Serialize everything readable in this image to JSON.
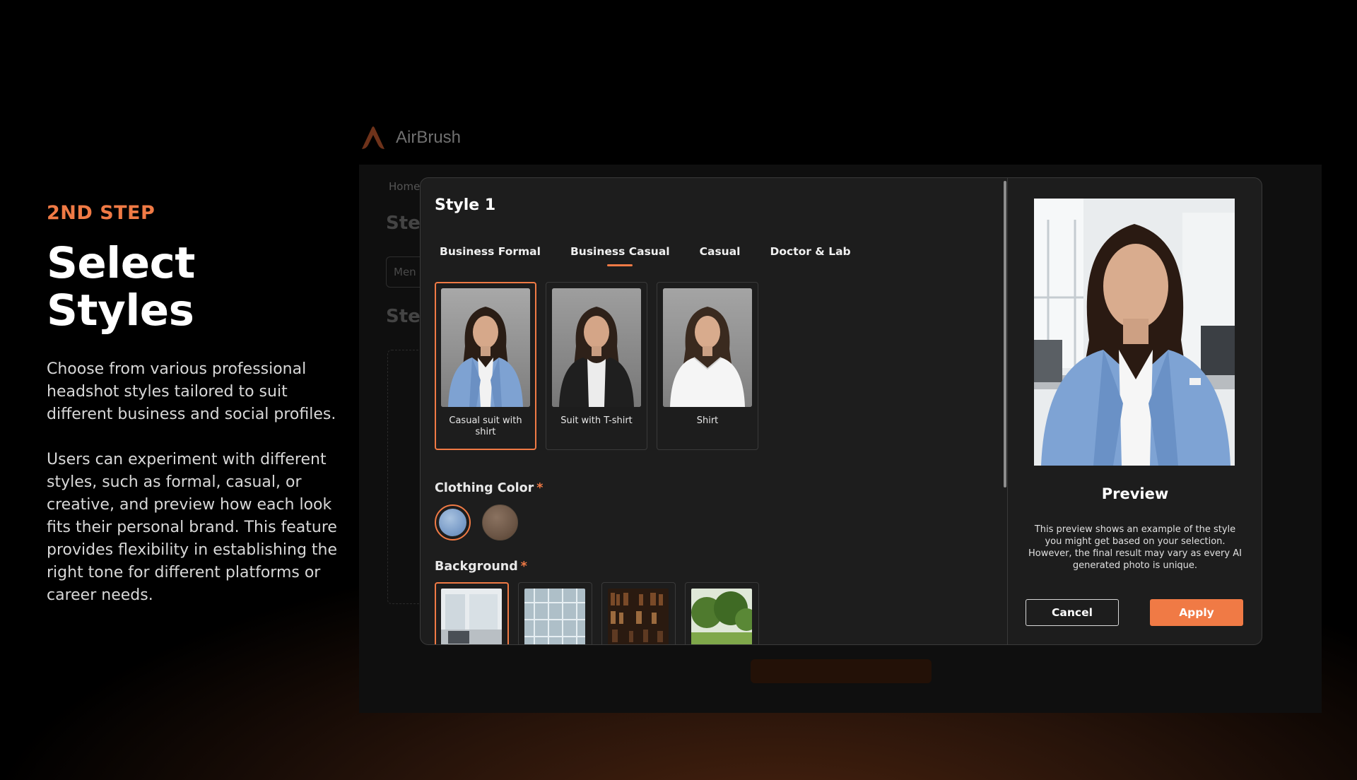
{
  "intro": {
    "step": "2ND STEP",
    "title": "Select Styles",
    "paragraph1": "Choose from various professional headshot styles tailored to suit different business and social profiles.",
    "paragraph2": "Users can experiment with different styles, such as formal, casual, or creative, and preview how each look fits their personal brand. This feature provides flexibility in establishing the right tone for different platforms or career needs."
  },
  "background_app": {
    "brand": "AirBrush",
    "breadcrumb": "Home",
    "step1": "Ste",
    "select": "Men",
    "step2": "Ste"
  },
  "modal": {
    "title": "Style 1",
    "tabs": [
      {
        "label": "Business Formal",
        "active": false
      },
      {
        "label": "Business Casual",
        "active": true
      },
      {
        "label": "Casual",
        "active": false
      },
      {
        "label": "Doctor & Lab",
        "active": false
      }
    ],
    "styles": [
      {
        "label": "Casual suit with shirt",
        "selected": true
      },
      {
        "label": "Suit with T-shirt",
        "selected": false
      },
      {
        "label": "Shirt",
        "selected": false
      }
    ],
    "clothing_color": {
      "label": "Clothing Color",
      "required_mark": "*",
      "options": [
        {
          "name": "light-blue",
          "color": "#7b9dc9",
          "selected": true
        },
        {
          "name": "brown",
          "color": "#6c5646",
          "selected": false
        }
      ]
    },
    "background": {
      "label": "Background",
      "required_mark": "*",
      "options": [
        {
          "name": "office",
          "selected": true
        },
        {
          "name": "glass-building",
          "selected": false
        },
        {
          "name": "library",
          "selected": false
        },
        {
          "name": "park",
          "selected": false
        }
      ]
    },
    "preview": {
      "title": "Preview",
      "description": "This preview shows an example of the style you might get based on your selection. However, the final result may vary as every AI generated photo is unique."
    },
    "buttons": {
      "cancel": "Cancel",
      "apply": "Apply"
    }
  },
  "colors": {
    "accent": "#f07a45",
    "modal_bg": "#1d1d1d",
    "page_bg": "#000000"
  }
}
